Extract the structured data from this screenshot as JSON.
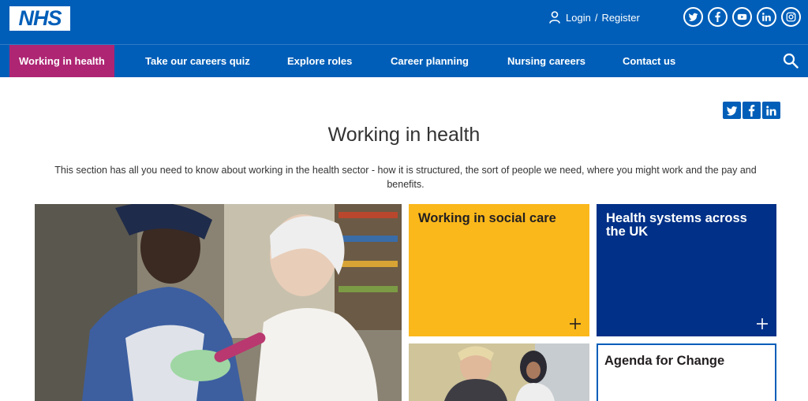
{
  "header": {
    "logo_text": "NHS",
    "login_label": "Login",
    "separator": "/",
    "register_label": "Register",
    "social_icons": [
      "twitter-icon",
      "facebook-icon",
      "youtube-icon",
      "linkedin-icon",
      "instagram-icon"
    ]
  },
  "nav": {
    "items": [
      {
        "label": "Working in health",
        "active": true
      },
      {
        "label": "Take our careers quiz"
      },
      {
        "label": "Explore roles"
      },
      {
        "label": "Career planning"
      },
      {
        "label": "Nursing careers"
      },
      {
        "label": "Contact us"
      }
    ]
  },
  "share": {
    "icons": [
      "twitter-icon",
      "facebook-icon",
      "linkedin-icon"
    ]
  },
  "main": {
    "title": "Working in health",
    "intro": "This section has all you need to know about working in the health sector - how it is structured, the sort of people we need, where you might work and the pay and benefits."
  },
  "tiles": {
    "social_care": "Working in social care",
    "health_systems": "Health systems across the UK",
    "agenda": "Agenda for Change"
  },
  "colors": {
    "nhs_blue": "#005eb8",
    "active_nav": "#ae2573",
    "warm_yellow": "#fbb81b",
    "dark_blue": "#003087"
  }
}
